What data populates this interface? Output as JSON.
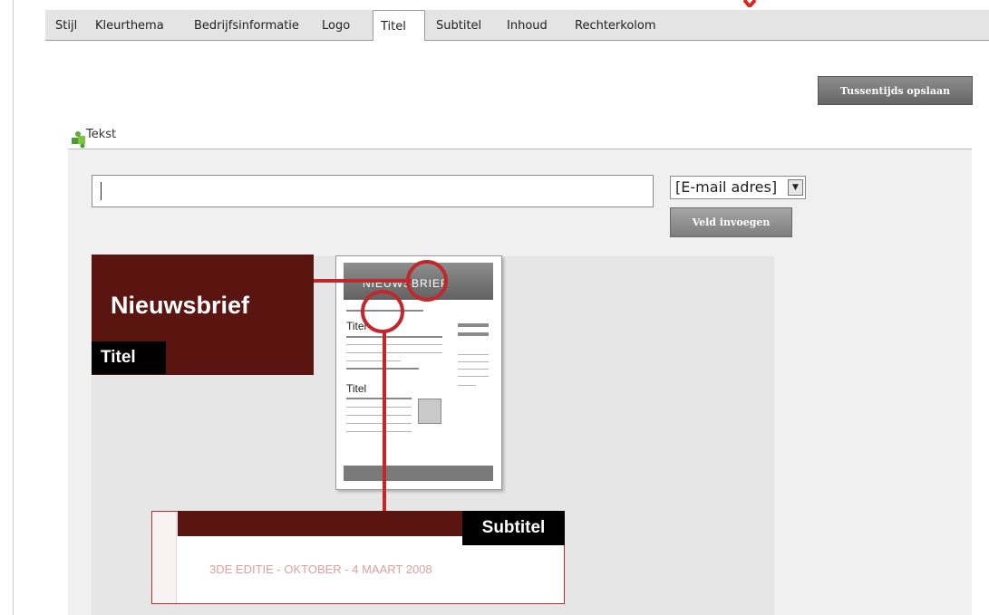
{
  "tabs": [
    {
      "label": "Stijl"
    },
    {
      "label": "Kleurthema"
    },
    {
      "label": "Bedrijfsinformatie"
    },
    {
      "label": "Logo"
    },
    {
      "label": "Titel"
    },
    {
      "label": "Subtitel"
    },
    {
      "label": "Inhoud"
    },
    {
      "label": "Rechterkolom"
    }
  ],
  "active_tab": "Titel",
  "toolbar": {
    "save_label": "Tussentijds opslaan"
  },
  "section": {
    "label": "Tekst",
    "icon": "puzzle-icon"
  },
  "editor": {
    "input_value": "",
    "field_select": {
      "selected": "[E-mail adres]"
    },
    "insert_label": "Veld invoegen"
  },
  "illustration": {
    "title_box_text": "Nieuwsbrief",
    "title_label": "Titel",
    "doc_header_text": "NIEUWSBRIEF",
    "doc_title_1": "Titel",
    "doc_title_2": "Titel",
    "subtitle_label": "Subtitel",
    "subtitle_text": "3DE EDITIE - OKTOBER - 4 MAART 2008"
  },
  "colors": {
    "accent_red": "#c1272d",
    "title_box": "#5a1510",
    "button_gray": "#7a7a7a"
  }
}
